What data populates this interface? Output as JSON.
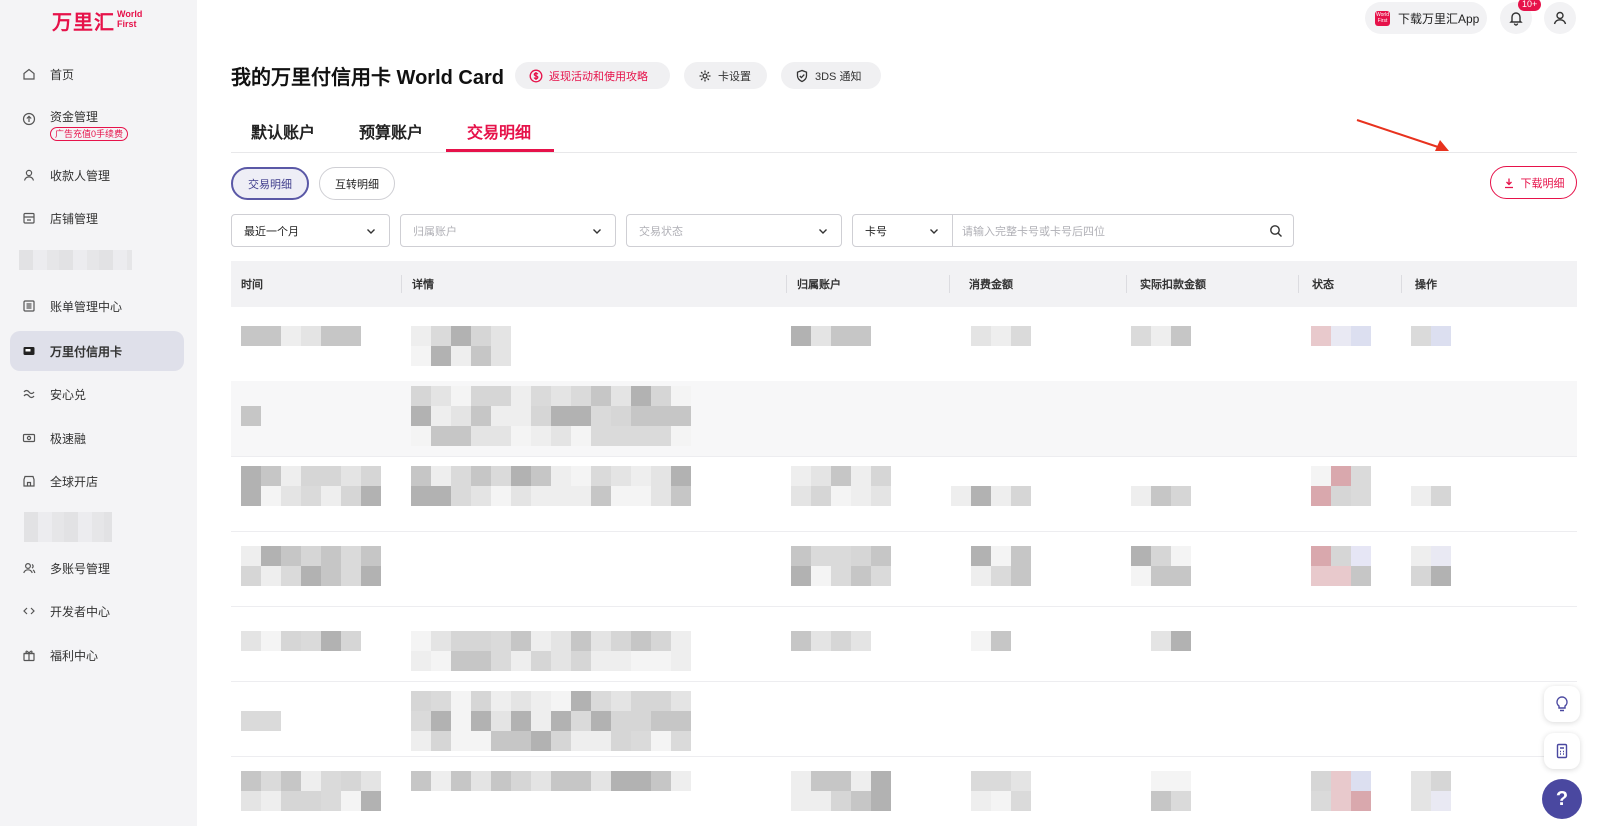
{
  "brand": {
    "name_cn": "万里汇",
    "name_en_1": "World",
    "name_en_2": "First"
  },
  "sidebar": {
    "items": [
      {
        "label": "首页"
      },
      {
        "label": "资金管理",
        "promo": "广告充值0手续费"
      },
      {
        "label": "收款人管理"
      },
      {
        "label": "店铺管理"
      },
      {
        "label": "账单管理中心"
      },
      {
        "label": "万里付信用卡"
      },
      {
        "label": "安心兑"
      },
      {
        "label": "极速融"
      },
      {
        "label": "全球开店"
      },
      {
        "label": "多账号管理"
      },
      {
        "label": "开发者中心"
      },
      {
        "label": "福利中心"
      }
    ]
  },
  "topbar": {
    "app_download": "下载万里汇App",
    "app_badge": "World First",
    "notif_count": "10+"
  },
  "header": {
    "title": "我的万里付信用卡 World Card",
    "promo_label": "返现活动和使用攻略",
    "card_settings": "卡设置",
    "threeds": "3DS 通知"
  },
  "tabs": [
    "默认账户",
    "预算账户",
    "交易明细"
  ],
  "active_tab": "交易明细",
  "subtabs": [
    "交易明细",
    "互转明细"
  ],
  "download_label": "下载明细",
  "filters": {
    "period": "最近一个月",
    "account_placeholder": "归属账户",
    "status_placeholder": "交易状态",
    "card_type": "卡号",
    "search_placeholder": "请输入完整卡号或卡号后四位"
  },
  "table": {
    "columns": [
      "时间",
      "详情",
      "归属账户",
      "消费金额",
      "实际扣款金额",
      "状态",
      "操作"
    ]
  },
  "colors": {
    "accent": "#e6124a",
    "primary": "#4a48a0"
  }
}
